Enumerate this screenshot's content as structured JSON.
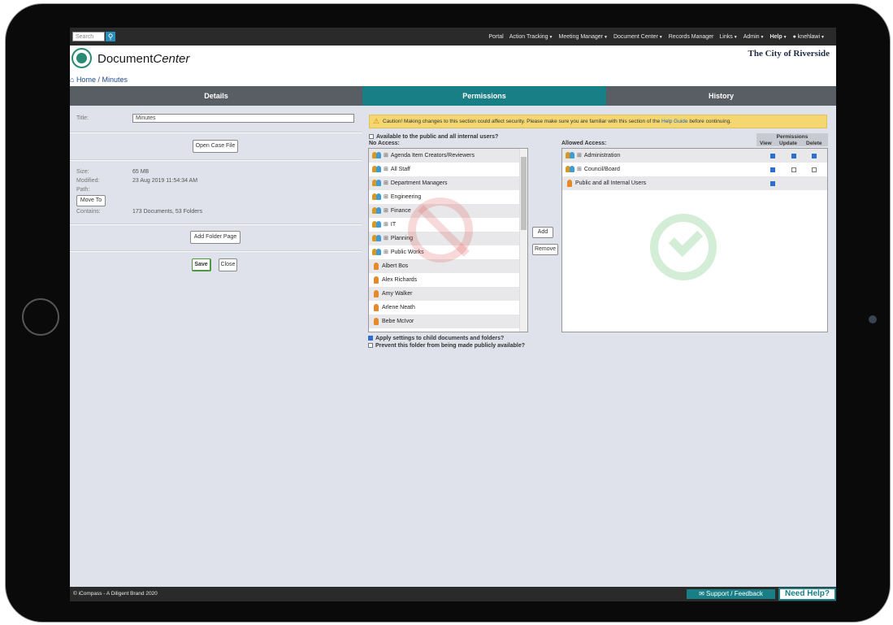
{
  "topbar": {
    "search_placeholder": "Search",
    "search_icon": "search-icon",
    "nav": [
      {
        "label": "Portal",
        "dropdown": false
      },
      {
        "label": "Action Tracking",
        "dropdown": true
      },
      {
        "label": "Meeting Manager",
        "dropdown": true
      },
      {
        "label": "Document Center",
        "dropdown": true
      },
      {
        "label": "Records Manager",
        "dropdown": false
      },
      {
        "label": "Links",
        "dropdown": true
      },
      {
        "label": "Admin",
        "dropdown": true
      },
      {
        "label": "Help",
        "dropdown": true
      },
      {
        "label": "knehlawi",
        "dropdown": true
      }
    ]
  },
  "header": {
    "logo_prefix": "Document",
    "logo_suffix": "Center",
    "org": "The City of Riverside",
    "breadcrumb": "Home / Minutes"
  },
  "tabs": [
    {
      "label": "Details",
      "active": false
    },
    {
      "label": "Permissions",
      "active": true
    },
    {
      "label": "History",
      "active": false
    }
  ],
  "details": {
    "title_label": "Title:",
    "title_value": "Minutes",
    "open_case_file": "Open Case File",
    "size_label": "Size:",
    "size_value": "65 MB",
    "modified_label": "Modified:",
    "modified_value": "23 Aug 2019 11:54:34 AM",
    "path_label": "Path:",
    "move_to": "Move To",
    "contains_label": "Contains:",
    "contains_value": "173 Documents, 53 Folders",
    "add_folder_page": "Add Folder Page",
    "save": "Save",
    "close": "Close"
  },
  "permissions": {
    "caution_text": "Caution! Making changes to this section could affect security. Please make sure you are familiar with this section of the",
    "caution_link": "Help Guide",
    "caution_after": "before continuing.",
    "available_public": "Available to the public and all internal users?",
    "available_checked": false,
    "no_access_label": "No Access:",
    "allowed_access_label": "Allowed Access:",
    "permissions_heading": "Permissions",
    "col_view": "View",
    "col_update": "Update",
    "col_delete": "Delete",
    "add": "Add",
    "remove": "Remove",
    "no_access": [
      {
        "name": "Agenda Item Creators/Reviewers",
        "type": "group"
      },
      {
        "name": "All Staff",
        "type": "group"
      },
      {
        "name": "Department Managers",
        "type": "group"
      },
      {
        "name": "Engineering",
        "type": "group"
      },
      {
        "name": "Finance",
        "type": "group"
      },
      {
        "name": "IT",
        "type": "group"
      },
      {
        "name": "Planning",
        "type": "group"
      },
      {
        "name": "Public Works",
        "type": "group"
      },
      {
        "name": "Albert Bos",
        "type": "user"
      },
      {
        "name": "Alex Richards",
        "type": "user"
      },
      {
        "name": "Amy Walker",
        "type": "user"
      },
      {
        "name": "Arlene Neath",
        "type": "user"
      },
      {
        "name": "Bebe McIvor",
        "type": "user"
      }
    ],
    "allowed_access": [
      {
        "name": "Administration",
        "type": "group",
        "view": true,
        "update": true,
        "delete": true
      },
      {
        "name": "Council/Board",
        "type": "group",
        "view": true,
        "update": false,
        "delete": false
      },
      {
        "name": "Public and all Internal Users",
        "type": "user",
        "view": true,
        "update": null,
        "delete": null
      }
    ],
    "apply_child": "Apply settings to child documents and folders?",
    "apply_child_checked": true,
    "prevent_public": "Prevent this folder from being made publicly available?",
    "prevent_public_checked": false
  },
  "footer": {
    "copyright": "© iCompass - A Diligent Brand 2020",
    "support": "Support / Feedback",
    "need_help": "Need Help?"
  },
  "colors": {
    "accent": "#187f86",
    "topbar": "#2a2a2a",
    "caution": "#f5d772",
    "help": "#48c04c"
  }
}
